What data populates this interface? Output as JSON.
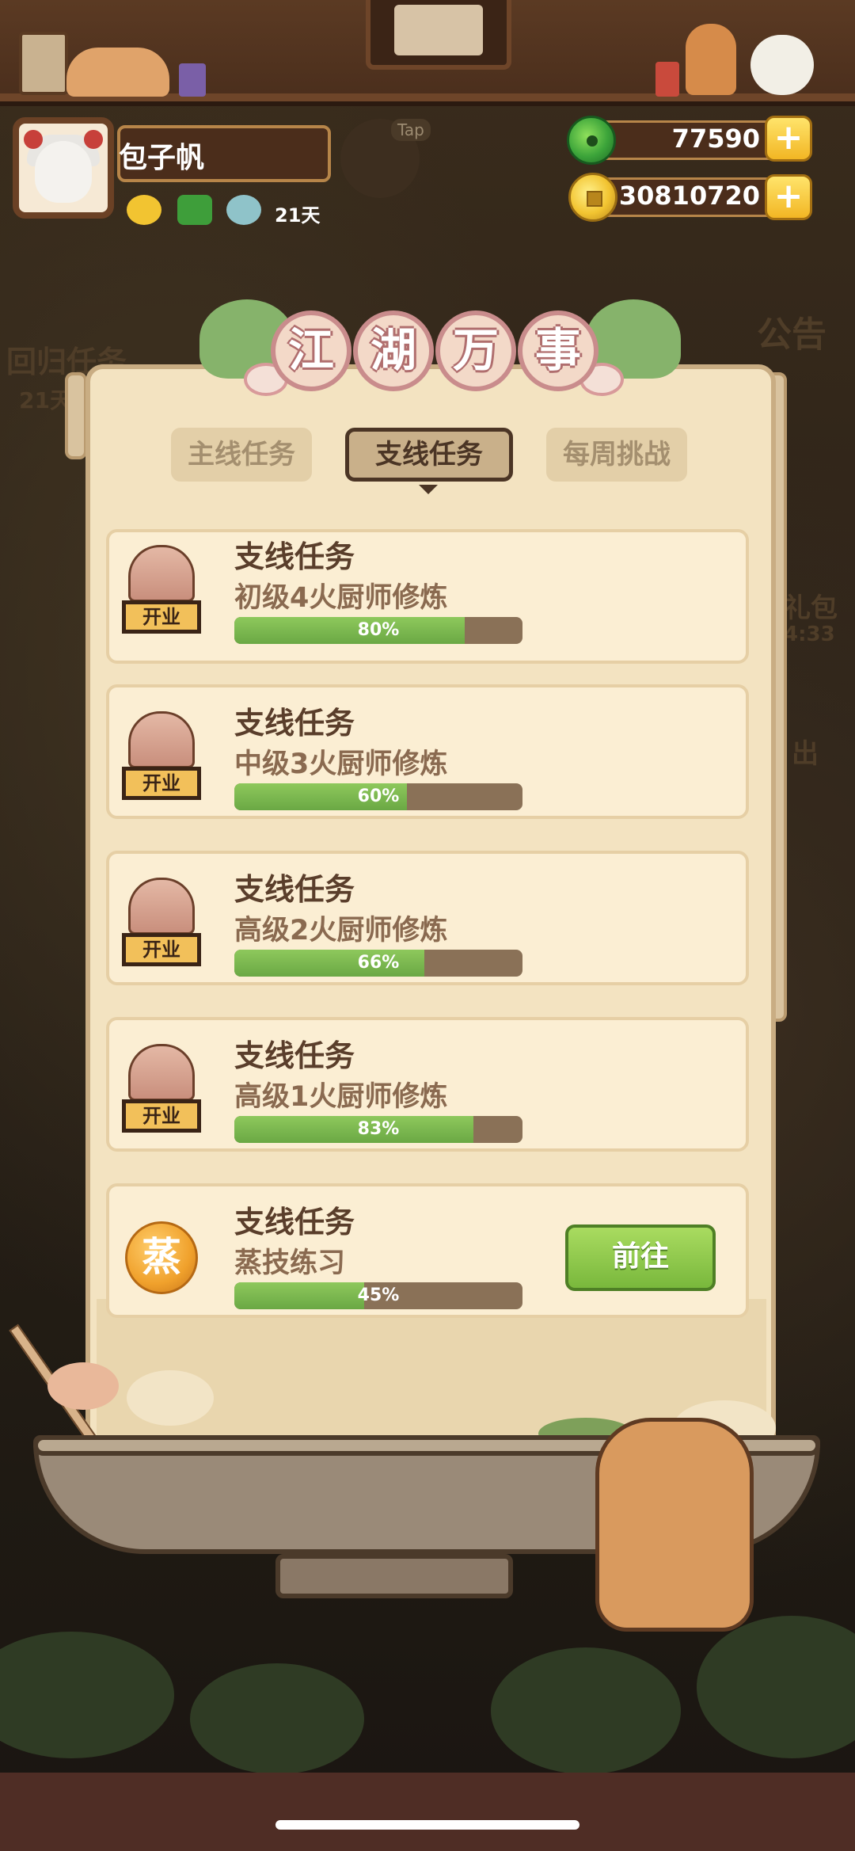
{
  "header": {
    "player_name": "包子帆",
    "days": "21天",
    "tap_label": "Tap"
  },
  "currency": {
    "jade": "77590",
    "coins": "30810720",
    "plus_symbol": "+"
  },
  "background_hints": {
    "left_label": "回归任务",
    "left_sub": "21天",
    "right_label": "公告",
    "right_gift": "礼包",
    "right_timer": "4:33",
    "right_out": "出"
  },
  "panel": {
    "title_chars": [
      "江",
      "湖",
      "万",
      "事"
    ],
    "tabs": [
      {
        "label": "主线任务",
        "active": false
      },
      {
        "label": "支线任务",
        "active": true
      },
      {
        "label": "每周挑战",
        "active": false
      }
    ],
    "tasks": [
      {
        "title": "支线任务",
        "desc": "初级4火厨师修炼",
        "progress": 0.8,
        "progress_label": "80%",
        "icon": "shop-icon",
        "icon_label": "开业"
      },
      {
        "title": "支线任务",
        "desc": "中级3火厨师修炼",
        "progress": 0.6,
        "progress_label": "60%",
        "icon": "shop-icon",
        "icon_label": "开业"
      },
      {
        "title": "支线任务",
        "desc": "高级2火厨师修炼",
        "progress": 0.66,
        "progress_label": "66%",
        "icon": "shop-icon",
        "icon_label": "开业"
      },
      {
        "title": "支线任务",
        "desc": "高级1火厨师修炼",
        "progress": 0.83,
        "progress_label": "83%",
        "icon": "shop-icon",
        "icon_label": "开业"
      },
      {
        "title": "支线任务",
        "desc": "蒸技练习",
        "progress": 0.45,
        "progress_label": "45%",
        "icon": "steam-badge",
        "icon_label": "蒸",
        "action_label": "前往"
      }
    ]
  },
  "colors": {
    "panel_bg": "#f3e3c1",
    "progress_fill": "#79b83c",
    "go_button": "#8ccb4c",
    "coin_plus": "#f7c942"
  }
}
